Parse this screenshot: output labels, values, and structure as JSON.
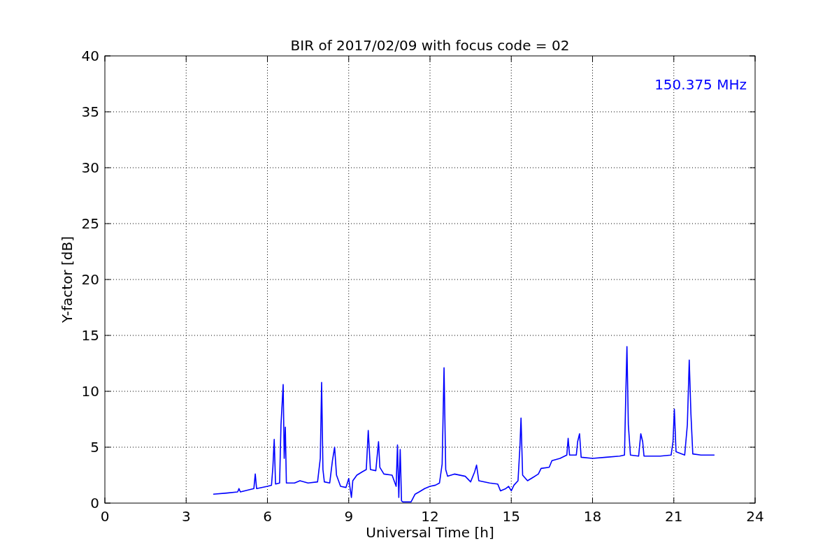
{
  "chart_data": {
    "type": "line",
    "title": "BIR of 2017/02/09 with focus code = 02",
    "xlabel": "Universal Time [h]",
    "ylabel": "Y-factor [dB]",
    "x": [
      4.0,
      4.5,
      4.9,
      4.95,
      5.0,
      5.5,
      5.55,
      5.6,
      6.0,
      6.15,
      6.2,
      6.25,
      6.3,
      6.45,
      6.5,
      6.58,
      6.62,
      6.66,
      6.7,
      7.0,
      7.2,
      7.5,
      7.85,
      7.95,
      8.0,
      8.05,
      8.1,
      8.3,
      8.4,
      8.48,
      8.55,
      8.7,
      8.9,
      9.0,
      9.1,
      9.15,
      9.3,
      9.5,
      9.65,
      9.72,
      9.8,
      10.0,
      10.1,
      10.15,
      10.3,
      10.6,
      10.75,
      10.8,
      10.85,
      10.9,
      10.95,
      11.0,
      11.3,
      11.45,
      11.6,
      11.8,
      12.0,
      12.2,
      12.35,
      12.45,
      12.52,
      12.58,
      12.65,
      12.9,
      13.3,
      13.5,
      13.65,
      13.72,
      13.8,
      14.2,
      14.5,
      14.6,
      14.8,
      14.9,
      15.0,
      15.1,
      15.25,
      15.32,
      15.36,
      15.42,
      15.6,
      15.8,
      16.0,
      16.1,
      16.4,
      16.5,
      16.8,
      17.05,
      17.1,
      17.15,
      17.4,
      17.45,
      17.52,
      17.58,
      18.0,
      18.5,
      19.0,
      19.18,
      19.22,
      19.27,
      19.32,
      19.4,
      19.7,
      19.78,
      19.85,
      19.9,
      20.5,
      20.9,
      20.97,
      21.02,
      21.08,
      21.4,
      21.5,
      21.57,
      21.63,
      21.7,
      22.0,
      22.5
    ],
    "series": [
      {
        "name": "150.375 MHz",
        "color": "#0000ff",
        "values": [
          0.8,
          0.9,
          1.0,
          1.3,
          1.0,
          1.3,
          2.6,
          1.3,
          1.5,
          1.6,
          3.2,
          5.7,
          1.7,
          1.8,
          7.0,
          10.6,
          4.0,
          6.8,
          1.8,
          1.8,
          2.0,
          1.8,
          1.9,
          4.0,
          10.8,
          3.0,
          1.9,
          1.8,
          3.8,
          5.0,
          2.5,
          1.5,
          1.4,
          2.2,
          0.5,
          2.0,
          2.5,
          2.8,
          3.0,
          6.5,
          3.0,
          2.9,
          5.5,
          3.2,
          2.6,
          2.5,
          1.5,
          5.2,
          0.5,
          4.8,
          0.2,
          0.1,
          0.1,
          0.8,
          1.0,
          1.3,
          1.5,
          1.6,
          1.8,
          3.5,
          12.1,
          3.0,
          2.4,
          2.6,
          2.4,
          1.9,
          2.8,
          3.4,
          2.0,
          1.8,
          1.7,
          1.1,
          1.3,
          1.5,
          1.1,
          1.6,
          2.0,
          5.0,
          7.6,
          2.5,
          2.0,
          2.3,
          2.6,
          3.1,
          3.2,
          3.8,
          4.0,
          4.3,
          5.8,
          4.3,
          4.3,
          5.5,
          6.2,
          4.1,
          4.0,
          4.1,
          4.2,
          4.3,
          9.0,
          14.0,
          7.0,
          4.3,
          4.2,
          6.2,
          5.5,
          4.2,
          4.2,
          4.3,
          5.5,
          8.4,
          4.6,
          4.3,
          7.0,
          12.8,
          8.0,
          4.4,
          4.3,
          4.3
        ]
      }
    ],
    "grid": true,
    "xlim": [
      0,
      24
    ],
    "ylim": [
      0,
      40
    ],
    "xticks": [
      0,
      3,
      6,
      9,
      12,
      15,
      18,
      21,
      24
    ],
    "yticks": [
      0,
      5,
      10,
      15,
      20,
      25,
      30,
      35,
      40
    ]
  }
}
